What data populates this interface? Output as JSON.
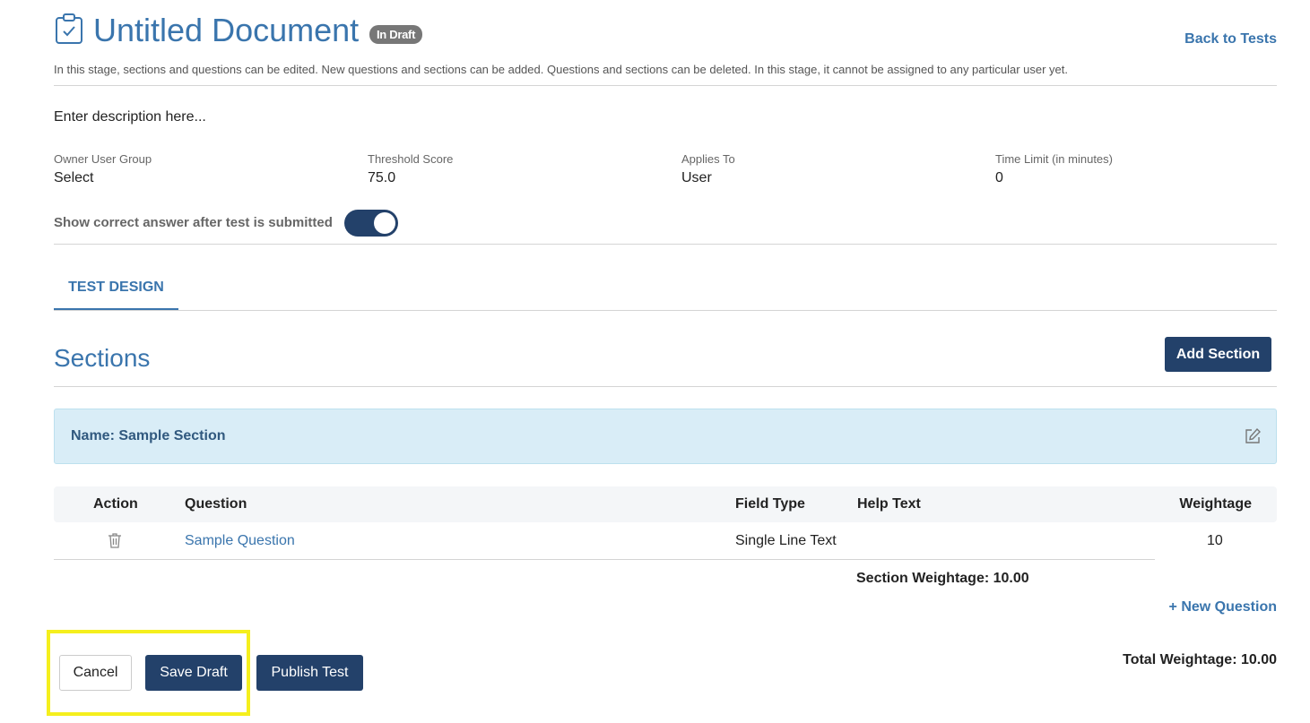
{
  "header": {
    "icon": "clipboard-check-icon",
    "title": "Untitled Document",
    "status_badge": "In Draft",
    "back_link": "Back to Tests",
    "stage_description": "In this stage, sections and questions can be edited. New questions and sections can be added. Questions and sections can be deleted. In this stage, it cannot be assigned to any particular user yet."
  },
  "description_placeholder": "Enter description here...",
  "fields": [
    {
      "label": "Owner User Group",
      "value": "Select"
    },
    {
      "label": "Threshold Score",
      "value": "75.0"
    },
    {
      "label": "Applies To",
      "value": "User"
    },
    {
      "label": "Time Limit (in minutes)",
      "value": "0"
    }
  ],
  "toggle": {
    "label": "Show correct answer after test is submitted",
    "state": "on"
  },
  "tabs": [
    {
      "label": "TEST DESIGN",
      "active": true
    }
  ],
  "sections": {
    "title": "Sections",
    "add_button": "Add Section",
    "items": [
      {
        "name_label": "Name: Sample Section",
        "edit_icon": "edit-icon",
        "table": {
          "headers": [
            "Action",
            "Question",
            "Field Type",
            "Help Text",
            "Weightage"
          ],
          "rows": [
            {
              "action_icon": "trash-icon",
              "question": "Sample Question",
              "field_type": "Single Line Text",
              "help_text": "",
              "weightage": "10"
            }
          ]
        },
        "section_weightage": "Section Weightage: 10.00",
        "new_question": "+ New Question"
      }
    ]
  },
  "total_weightage": "Total Weightage: 10.00",
  "footer": {
    "cancel": "Cancel",
    "save_draft": "Save Draft",
    "publish": "Publish Test"
  },
  "colors": {
    "accent": "#3a75ad",
    "primary_button": "#23416a",
    "section_bg": "#d9edf7",
    "badge_bg": "#777777",
    "highlight": "#f5ef1d"
  }
}
